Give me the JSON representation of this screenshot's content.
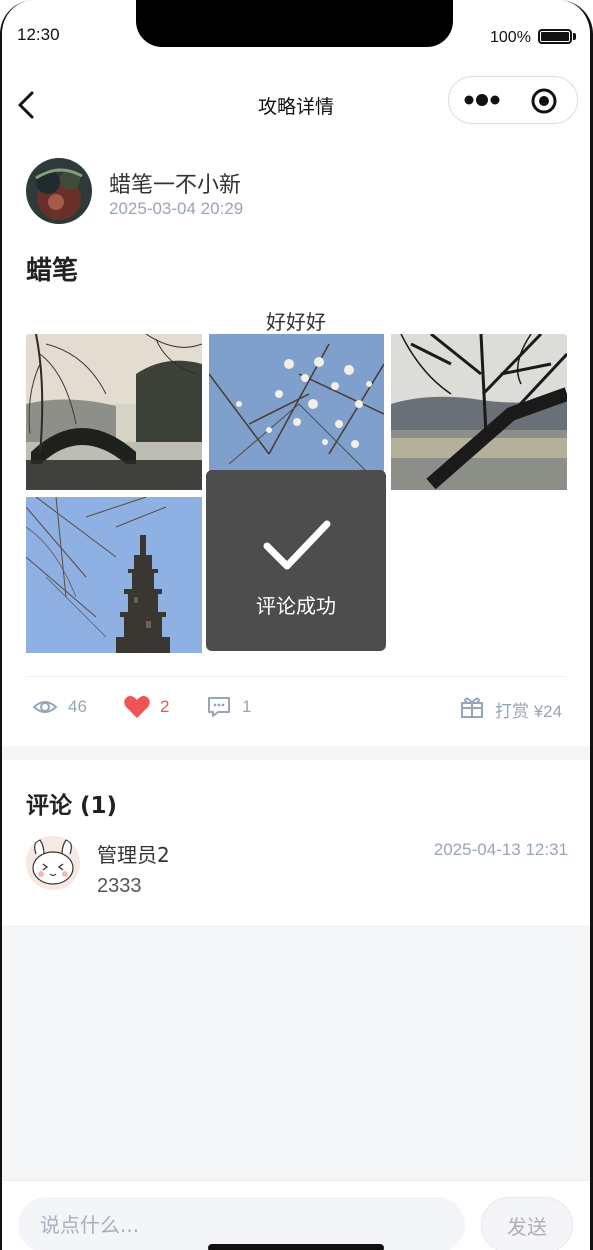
{
  "status_bar": {
    "time": "12:30",
    "battery": "100%"
  },
  "nav": {
    "title": "攻略详情"
  },
  "post": {
    "author": "蜡笔一不小新",
    "date": "2025-03-04 20:29",
    "title": "蜡笔",
    "text": "好好好",
    "images": [
      "bridge-photo",
      "magnolia-photo",
      "lake-branches-photo",
      "pagoda-photo"
    ],
    "stats": {
      "views": "46",
      "likes": "2",
      "comments": "1",
      "reward": "打赏 ¥24"
    }
  },
  "toast": {
    "text": "评论成功"
  },
  "comments": {
    "title": "评论 (1)",
    "items": [
      {
        "name": "管理员2",
        "time": "2025-04-13 12:31",
        "text": "2333"
      }
    ]
  },
  "bottom": {
    "placeholder": "说点什么...",
    "send_label": "发送"
  },
  "colors": {
    "meta": "#98a4b8",
    "like": "#f05454",
    "toast": "#4d4d4d"
  }
}
